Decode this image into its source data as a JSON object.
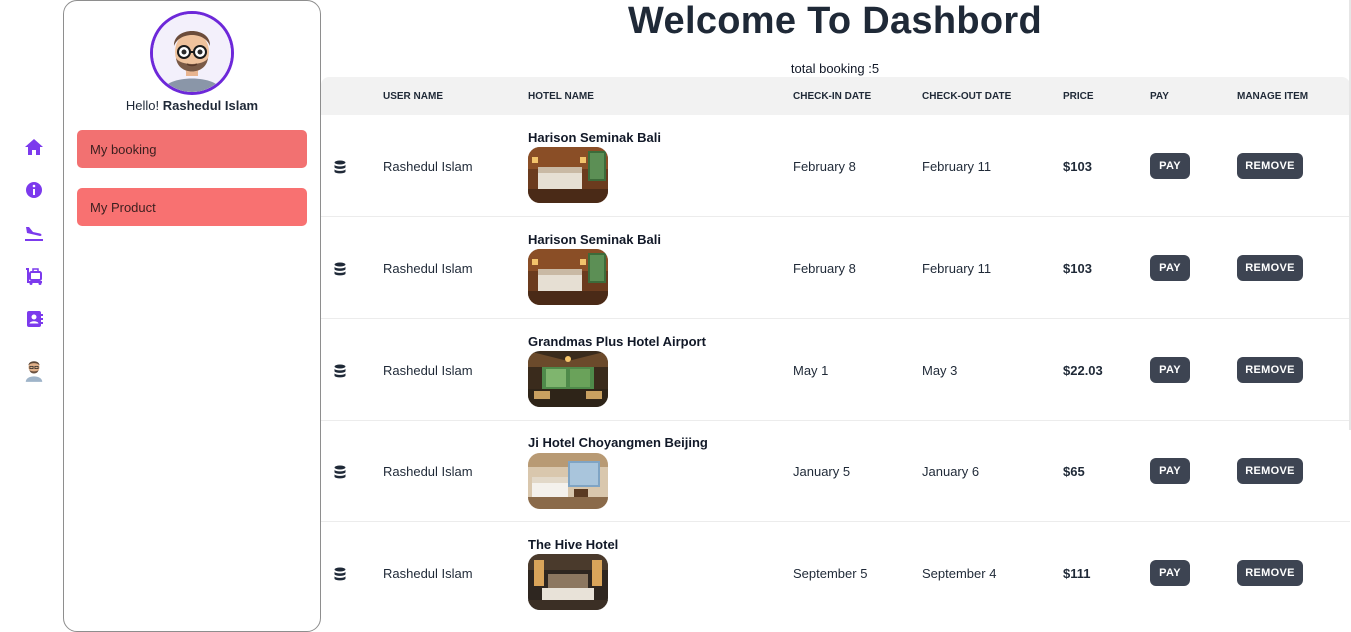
{
  "colors": {
    "accent": "#6d28d9",
    "sidebar_button": "#f87171",
    "action_button": "#3d4452",
    "header_bg": "#f2f2f2"
  },
  "rail": {
    "icons": [
      "home-icon",
      "info-icon",
      "plane-landing-icon",
      "luggage-cart-icon",
      "address-book-icon",
      "user-avatar-icon"
    ]
  },
  "sidebar": {
    "greeting": "Hello!",
    "user_name": "Rashedul Islam",
    "buttons": [
      "My booking",
      "My Product"
    ]
  },
  "main": {
    "title": "Welcome To Dashbord",
    "total_booking": "total booking :5"
  },
  "table": {
    "headers": [
      "USER NAME",
      "HOTEL NAME",
      "CHECK-IN DATE",
      "CHECK-OUT DATE",
      "PRICE",
      "PAY",
      "MANAGE ITEM"
    ],
    "pay_label": "PAY",
    "remove_label": "REMOVE",
    "rows": [
      {
        "user": "Rashedul Islam",
        "hotel": "Harison Seminak Bali",
        "check_in": "February 8",
        "check_out": "February 11",
        "price": "$103",
        "image": "hotel-room-photo"
      },
      {
        "user": "Rashedul Islam",
        "hotel": "Harison Seminak Bali",
        "check_in": "February 8",
        "check_out": "February 11",
        "price": "$103",
        "image": "hotel-room-photo"
      },
      {
        "user": "Rashedul Islam",
        "hotel": "Grandmas Plus Hotel Airport",
        "check_in": "May 1",
        "check_out": "May 3",
        "price": "$22.03",
        "image": "hotel-lobby-photo"
      },
      {
        "user": "Rashedul Islam",
        "hotel": "Ji Hotel Choyangmen Beijing",
        "check_in": "January 5",
        "check_out": "January 6",
        "price": "$65",
        "image": "hotel-room-photo"
      },
      {
        "user": "Rashedul Islam",
        "hotel": "The Hive Hotel",
        "check_in": "September 5",
        "check_out": "September 4",
        "price": "$111",
        "image": "hotel-room-photo"
      }
    ]
  }
}
